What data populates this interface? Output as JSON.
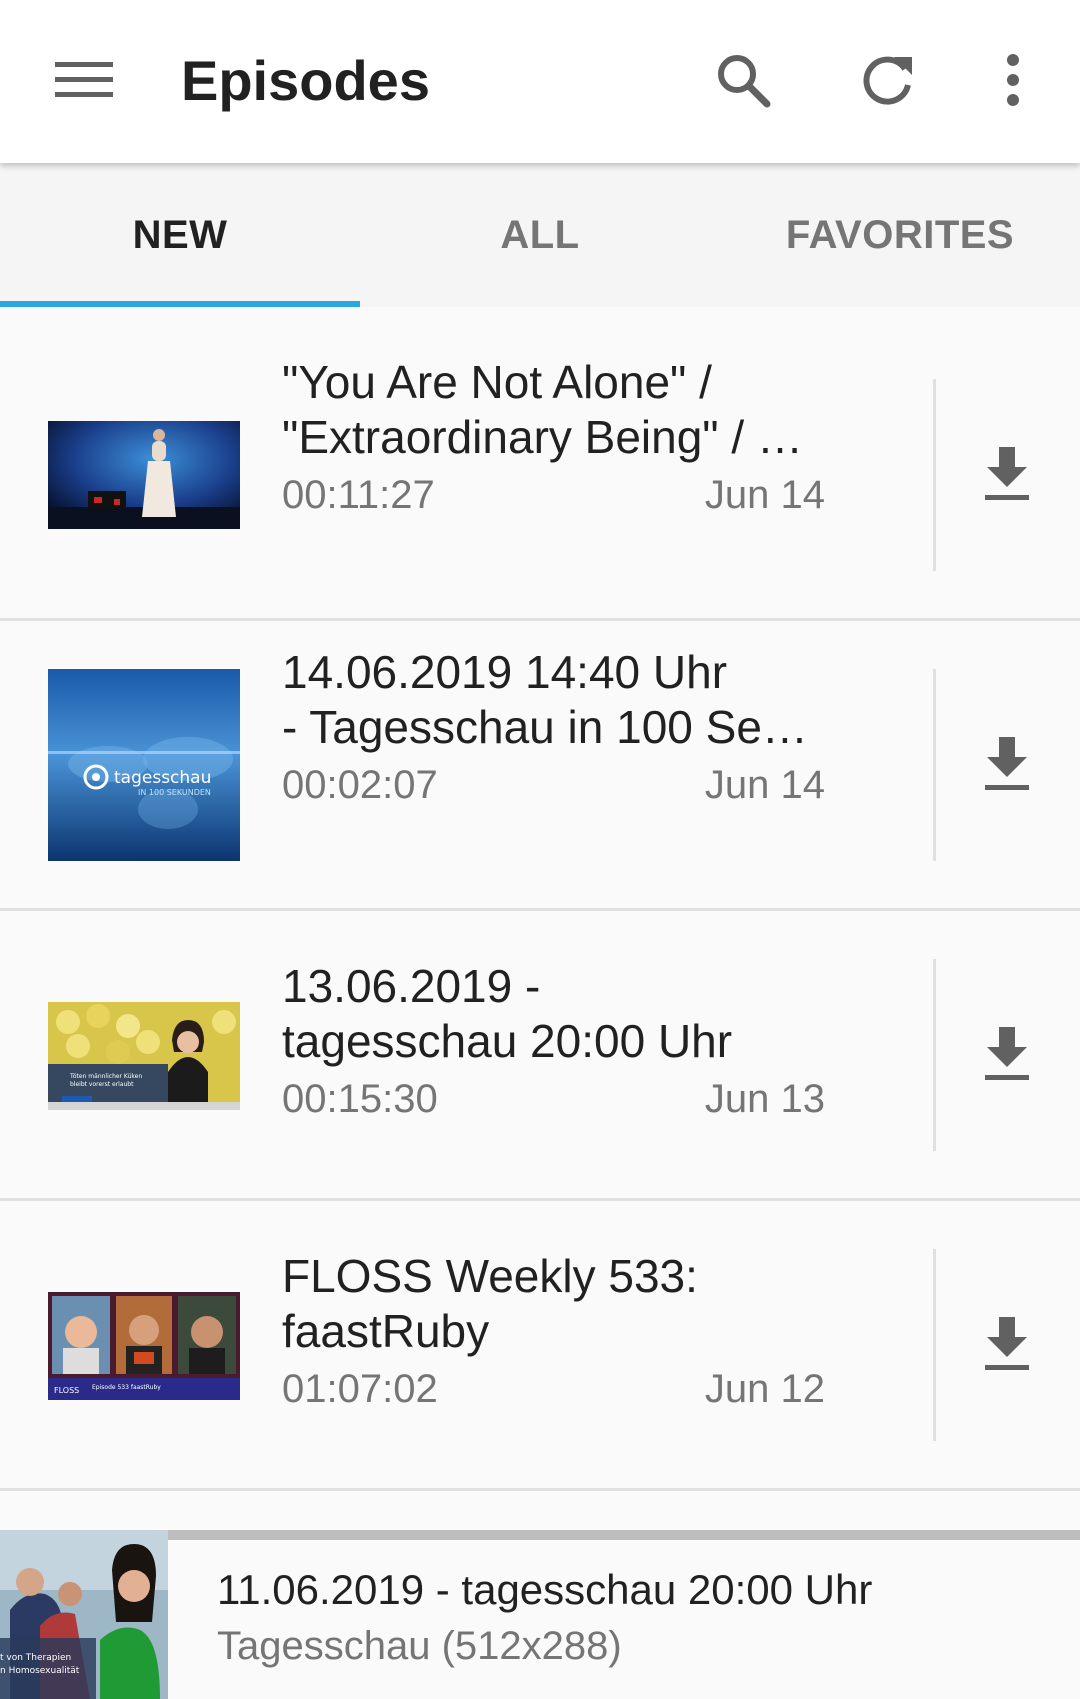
{
  "toolbar": {
    "title": "Episodes",
    "icons": [
      "menu-icon",
      "search-icon",
      "refresh-icon",
      "more-vert-icon"
    ]
  },
  "tabs": [
    {
      "label": "NEW",
      "active": true
    },
    {
      "label": "ALL",
      "active": false
    },
    {
      "label": "FAVORITES",
      "active": false
    }
  ],
  "colors": {
    "accent": "#29a7e1",
    "text_primary": "#212121",
    "text_secondary": "#757575"
  },
  "episodes": [
    {
      "title": "\"You Are Not Alone\" /\n\"Extraordinary Being\" / …",
      "duration": "00:11:27",
      "date": "Jun 14",
      "thumbnail": "stage-performance-thumbnail"
    },
    {
      "title": "14.06.2019 14:40 Uhr\n- Tagesschau in 100 Se…",
      "duration": "00:02:07",
      "date": "Jun 14",
      "thumbnail": "tagesschau-100-sekunden-thumbnail",
      "thumb_brand": "tagesschau",
      "thumb_sub": "IN 100 SEKUNDEN"
    },
    {
      "title": "13.06.2019 -\ntagesschau 20:00 Uhr",
      "duration": "00:15:30",
      "date": "Jun 13",
      "thumbnail": "news-anchor-chicks-thumbnail",
      "thumb_caption": "Töten männlicher Küken\nbleibt vorerst erlaubt"
    },
    {
      "title": "FLOSS Weekly 533:\nfaastRuby",
      "duration": "01:07:02",
      "date": "Jun 12",
      "thumbnail": "floss-weekly-hosts-thumbnail",
      "thumb_caption": "Episode 533 faastRuby"
    }
  ],
  "player": {
    "title": "11.06.2019 - tagesschau 20:00 Uhr",
    "subtitle": "Tagesschau (512x288)",
    "thumb_caption": "t von Therapien\nn Homosexualität"
  }
}
